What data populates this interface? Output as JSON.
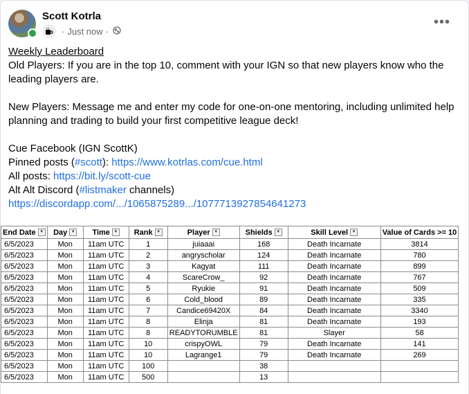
{
  "post": {
    "author": "Scott Kotrla",
    "time": "Just now",
    "separator": "·",
    "icons": {
      "coffee": "coffee-icon",
      "audience": "globe-icon",
      "more": "more-options-icon"
    },
    "lines": {
      "heading": "Weekly Leaderboard",
      "old_players": "Old Players: If you are in the top 10, comment with your IGN so that new players know who the leading players are.",
      "new_players": "New Players: Message me and enter my code for one-on-one mentoring, including unlimited help planning and trading to build your first competitive league deck!",
      "cue_facebook": "Cue Facebook (IGN ScottK)",
      "pinned_prefix": "Pinned posts (",
      "pinned_hashtag": "#scott",
      "pinned_mid": "): ",
      "pinned_link": "https://www.kotrlas.com/cue.html",
      "all_prefix": "All posts: ",
      "all_link": "https://bit.ly/scott-cue",
      "alt_prefix": "Alt Alt Discord (",
      "alt_hashtag": "#listmaker",
      "alt_suffix": " channels)",
      "discord_link": "https://discordapp.com/.../1065875289.../1077713927854641273"
    }
  },
  "sheet": {
    "columns": [
      "End Date",
      "Day",
      "Time",
      "Rank",
      "Player",
      "Shields",
      "Skill Level",
      "Value of Cards >= 10"
    ],
    "filter_icons": [
      "filter-active",
      "filter-active",
      "filter-active",
      "dropdown",
      "dropdown",
      "dropdown",
      "dropdown",
      ""
    ],
    "rows": [
      [
        "6/5/2023",
        "Mon",
        "11am UTC",
        "1",
        "juiaaai",
        "168",
        "Death Incarnate",
        "3814"
      ],
      [
        "6/5/2023",
        "Mon",
        "11am UTC",
        "2",
        "angryscholar",
        "124",
        "Death Incarnate",
        "780"
      ],
      [
        "6/5/2023",
        "Mon",
        "11am UTC",
        "3",
        "Kagyat",
        "111",
        "Death Incarnate",
        "899"
      ],
      [
        "6/5/2023",
        "Mon",
        "11am UTC",
        "4",
        "ScareCrow_",
        "92",
        "Death Incarnate",
        "767"
      ],
      [
        "6/5/2023",
        "Mon",
        "11am UTC",
        "5",
        "Ryukie",
        "91",
        "Death Incarnate",
        "509"
      ],
      [
        "6/5/2023",
        "Mon",
        "11am UTC",
        "6",
        "Cold_blood",
        "89",
        "Death Incarnate",
        "335"
      ],
      [
        "6/5/2023",
        "Mon",
        "11am UTC",
        "7",
        "Candice69420X",
        "84",
        "Death Incarnate",
        "3340"
      ],
      [
        "6/5/2023",
        "Mon",
        "11am UTC",
        "8",
        "Elinja",
        "81",
        "Death Incarnate",
        "193"
      ],
      [
        "6/5/2023",
        "Mon",
        "11am UTC",
        "8",
        "READYTORUMBLE",
        "81",
        "Slayer",
        "58"
      ],
      [
        "6/5/2023",
        "Mon",
        "11am UTC",
        "10",
        "crispyOWL",
        "79",
        "Death Incarnate",
        "141"
      ],
      [
        "6/5/2023",
        "Mon",
        "11am UTC",
        "10",
        "Lagrange1",
        "79",
        "Death Incarnate",
        "269"
      ],
      [
        "6/5/2023",
        "Mon",
        "11am UTC",
        "100",
        "",
        "38",
        "",
        ""
      ],
      [
        "6/5/2023",
        "Mon",
        "11am UTC",
        "500",
        "",
        "13",
        "",
        ""
      ]
    ]
  },
  "colors": {
    "link": "#216fdb",
    "online": "#31a24c",
    "meta": "#65676b"
  }
}
